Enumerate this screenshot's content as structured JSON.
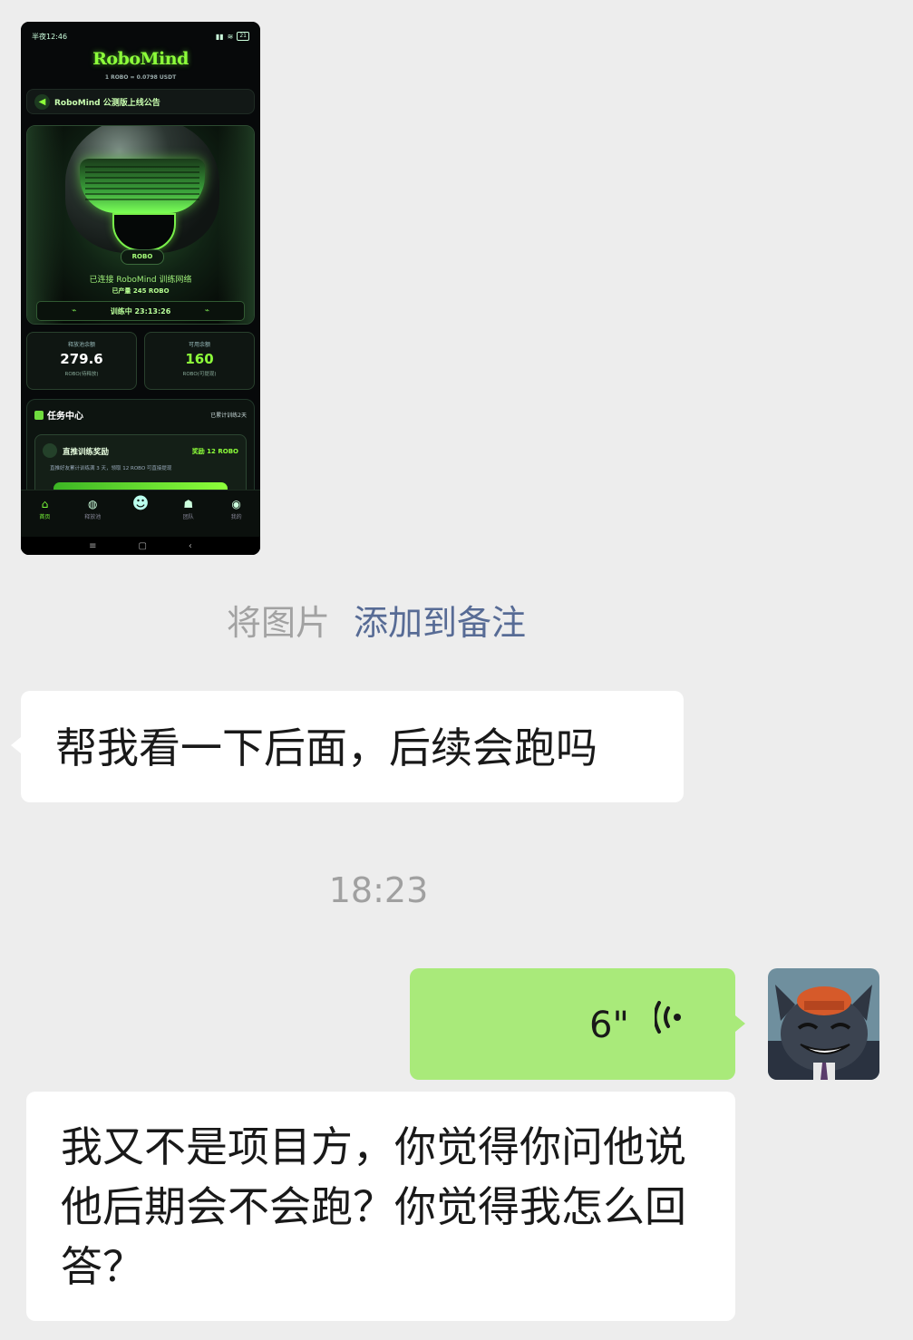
{
  "phone_screenshot": {
    "status_bar": {
      "time": "半夜12:46",
      "battery": "21"
    },
    "app_name": "RoboMind",
    "rate": "1 ROBO = 0.0798 USDT",
    "notice": "RoboMind 公测版上线公告",
    "hero": {
      "tag": "ROBO",
      "connected": "已连接 RoboMind 训练网络",
      "produced": "已产量 245 ROBO",
      "training": "训练中 23:13:26"
    },
    "cards": [
      {
        "label": "释放池余额",
        "value": "279.6",
        "unit": "ROBO(待释放)"
      },
      {
        "label": "可用余额",
        "value": "160",
        "unit": "ROBO(可提现)"
      }
    ],
    "tasks": {
      "title": "任务中心",
      "days": "已累计训练2天",
      "item_title": "直推训练奖励",
      "item_reward": "奖励 12 ROBO",
      "item_desc": "直推好友累计训练满 3 天，领取 12 ROBO 可直接提现"
    },
    "tabs": [
      {
        "icon": "⌂",
        "label": "首页"
      },
      {
        "icon": "◍",
        "label": "释放池"
      },
      {
        "icon": "☻",
        "label": ""
      },
      {
        "icon": "☗",
        "label": "团队"
      },
      {
        "icon": "◉",
        "label": "我的"
      }
    ],
    "nav": [
      "≡",
      "▢",
      "‹"
    ]
  },
  "note_prompt": {
    "prefix": "将图片",
    "link": "添加到备注"
  },
  "messages": {
    "m1": "帮我看一下后面，后续会跑吗",
    "time": "18:23",
    "voice_duration": "6\"",
    "m3": "我又不是项目方，你觉得你问他说他后期会不会跑？你觉得我怎么回答？"
  },
  "colors": {
    "chat_bg": "#ededed",
    "bubble_self": "#a9ea7a",
    "bubble_other": "#ffffff",
    "link": "#576b95",
    "app_accent": "#8dff3a"
  }
}
